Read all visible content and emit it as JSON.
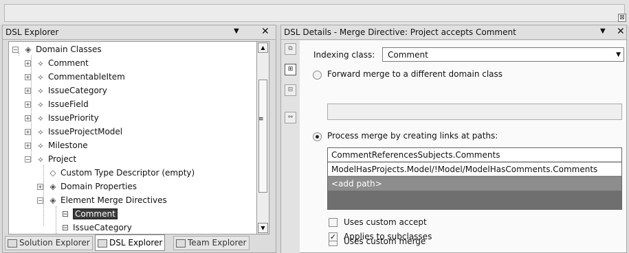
{
  "topbar": {
    "close_glyph": "⊠"
  },
  "explorer": {
    "title": "DSL Explorer",
    "dropdown_glyph": "▼",
    "close_glyph": "✕",
    "tree": [
      {
        "label": "Domain Classes",
        "icon": "domain-classes-icon",
        "glyph": "◈",
        "expander": "−"
      },
      {
        "label": "Comment",
        "icon": "class-icon",
        "glyph": "⟡",
        "expander": "+"
      },
      {
        "label": "CommentableItem",
        "icon": "class-icon",
        "glyph": "⟡",
        "expander": "+"
      },
      {
        "label": "IssueCategory",
        "icon": "class-icon",
        "glyph": "⟡",
        "expander": "+"
      },
      {
        "label": "IssueField",
        "icon": "class-icon",
        "glyph": "⟡",
        "expander": "+"
      },
      {
        "label": "IssuePriority",
        "icon": "class-icon",
        "glyph": "⟡",
        "expander": "+"
      },
      {
        "label": "IssueProjectModel",
        "icon": "class-icon",
        "glyph": "⟡",
        "expander": "+"
      },
      {
        "label": "Milestone",
        "icon": "class-icon",
        "glyph": "⟡",
        "expander": "+"
      },
      {
        "label": "Project",
        "icon": "class-icon",
        "glyph": "⟡",
        "expander": "−"
      },
      {
        "label": "Custom Type Descriptor (empty)",
        "icon": "descriptor-icon",
        "glyph": "◇",
        "expander": ""
      },
      {
        "label": "Domain Properties",
        "icon": "folder-icon",
        "glyph": "◈",
        "expander": "+"
      },
      {
        "label": "Element Merge Directives",
        "icon": "folder-icon",
        "glyph": "◈",
        "expander": "−"
      },
      {
        "label": "Comment",
        "icon": "merge-directive-icon",
        "glyph": "⊟",
        "expander": "",
        "selected": true
      },
      {
        "label": "IssueCategory",
        "icon": "merge-directive-icon",
        "glyph": "⊟",
        "expander": ""
      }
    ],
    "scroll": {
      "up": "▲",
      "down": "▼",
      "grip": "≡"
    },
    "tabs": [
      {
        "label": "Solution Explorer",
        "icon": "solution-explorer-icon"
      },
      {
        "label": "DSL Explorer",
        "icon": "dsl-explorer-icon",
        "active": true
      },
      {
        "label": "Team Explorer",
        "icon": "team-explorer-icon"
      }
    ]
  },
  "details": {
    "title": "DSL Details - Merge Directive: Project accepts Comment",
    "dropdown_glyph": "▼",
    "close_glyph": "✕",
    "toolbar": [
      {
        "icon": "view-icon",
        "glyph": "⧉"
      },
      {
        "icon": "merge-directives-icon",
        "glyph": "⊞",
        "active": true
      },
      {
        "icon": "hierarchy-icon",
        "glyph": "⊟"
      },
      {
        "icon": "links-icon",
        "glyph": "⇔"
      }
    ],
    "indexing_label": "Indexing class:",
    "indexing_value": "Comment",
    "combo_arrow": "▼",
    "forward_label": "Forward merge to a different domain class",
    "forward_value": "",
    "process_label": "Process merge by creating links at paths:",
    "paths": [
      "CommentReferencesSubjects.Comments",
      "ModelHasProjects.Model/!Model/ModelHasComments.Comments"
    ],
    "add_path": "<add path>",
    "options": [
      {
        "label": "Uses custom accept",
        "checked": false
      },
      {
        "label": "Uses custom merge",
        "checked": false
      },
      {
        "label": "Applies to subclasses",
        "checked": true
      }
    ],
    "check_glyph": "✓"
  }
}
